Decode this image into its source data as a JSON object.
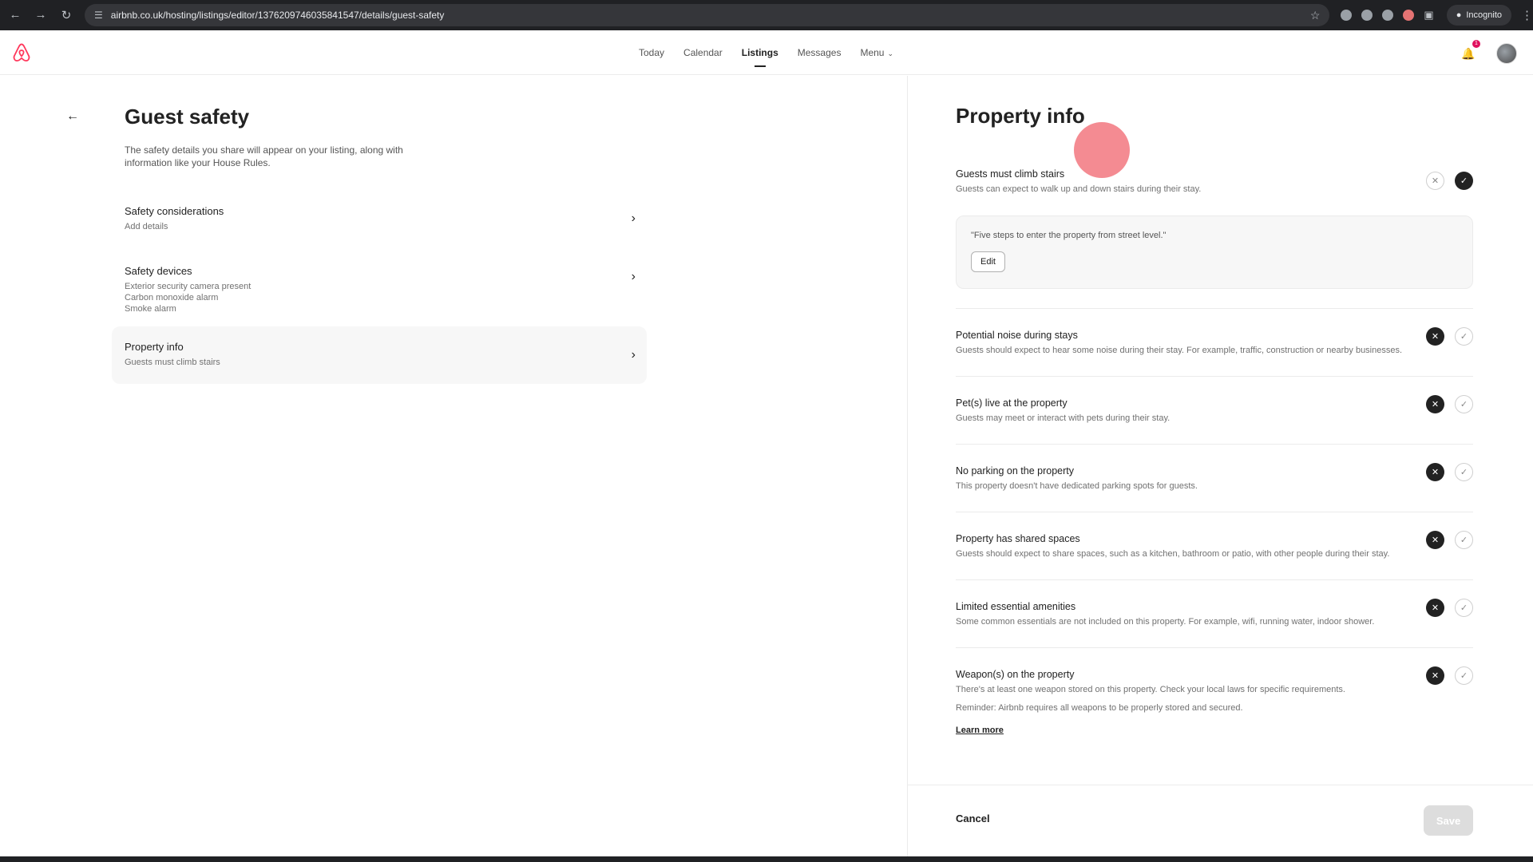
{
  "browser": {
    "url": "airbnb.co.uk/hosting/listings/editor/1376209746035841547/details/guest-safety",
    "incognito_label": "Incognito"
  },
  "topnav": {
    "links": [
      "Today",
      "Calendar",
      "Listings",
      "Messages",
      "Menu"
    ],
    "active": "Listings",
    "notification_count": "1"
  },
  "left": {
    "title": "Guest safety",
    "description": "The safety details you share will appear on your listing, along with information like your House Rules.",
    "sections": [
      {
        "title": "Safety considerations",
        "lines": [
          "Add details"
        ]
      },
      {
        "title": "Safety devices",
        "lines": [
          "Exterior security camera present",
          "Carbon monoxide alarm",
          "Smoke alarm"
        ]
      },
      {
        "title": "Property info",
        "lines": [
          "Guests must climb stairs"
        ]
      }
    ]
  },
  "right": {
    "title": "Property info",
    "stairs": {
      "title": "Guests must climb stairs",
      "desc": "Guests can expect to walk up and down stairs during their stay.",
      "state": "yes",
      "note": "\"Five steps to enter the property from street level.\"",
      "edit_label": "Edit"
    },
    "items": [
      {
        "title": "Potential noise during stays",
        "desc": "Guests should expect to hear some noise during their stay. For example, traffic, construction or nearby businesses.",
        "state": "no"
      },
      {
        "title": "Pet(s) live at the property",
        "desc": "Guests may meet or interact with pets during their stay.",
        "state": "no"
      },
      {
        "title": "No parking on the property",
        "desc": "This property doesn't have dedicated parking spots for guests.",
        "state": "no"
      },
      {
        "title": "Property has shared spaces",
        "desc": "Guests should expect to share spaces, such as a kitchen, bathroom or patio, with other people during their stay.",
        "state": "no"
      },
      {
        "title": "Limited essential amenities",
        "desc": "Some common essentials are not included on this property. For example, wifi, running water, indoor shower.",
        "state": "no"
      },
      {
        "title": "Weapon(s) on the property",
        "desc": "There's at least one weapon stored on this property. Check your local laws for specific requirements.",
        "state": "no"
      }
    ],
    "reminder": "Reminder: Airbnb requires all weapons to be properly stored and secured.",
    "learn_more": "Learn more",
    "cancel": "Cancel",
    "save": "Save"
  },
  "colors": {
    "brand": "#FF385C",
    "selected": "#222222",
    "save_disabled": "#DDDDDD"
  }
}
